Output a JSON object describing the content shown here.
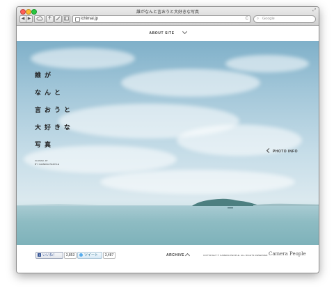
{
  "window": {
    "title": "誰がなんと言おうと大好きな写真",
    "url": "ichimai.jp",
    "search_placeholder": "Google"
  },
  "toolbar": {
    "back": "◀",
    "forward": "▶",
    "reload": "C",
    "fullscreen": "⤢"
  },
  "nav": {
    "about_label": "ABOUT SITE"
  },
  "hero": {
    "title_lines": [
      "誰が",
      "なんと",
      "言おうと",
      "大好きな",
      "写真"
    ],
    "caption_line1": "ICHIMAI.JP",
    "caption_line2": "BY CAMERA PEOPLE",
    "photo_info": "PHOTO INFO"
  },
  "footer": {
    "like_label": "いいね！",
    "like_count": "3,853",
    "tweet_label": "ツイート",
    "tweet_count": "3,487",
    "archive_label": "ARCHIVE",
    "copyright": "COPYRIGHT © CAMERA PEOPLE. ALL RIGHTS RESERVED.",
    "brand": "Camera People"
  },
  "colors": {
    "sky_top": "#7fb0c9",
    "sea": "#8ebcc3",
    "island": "#4d7f80"
  }
}
